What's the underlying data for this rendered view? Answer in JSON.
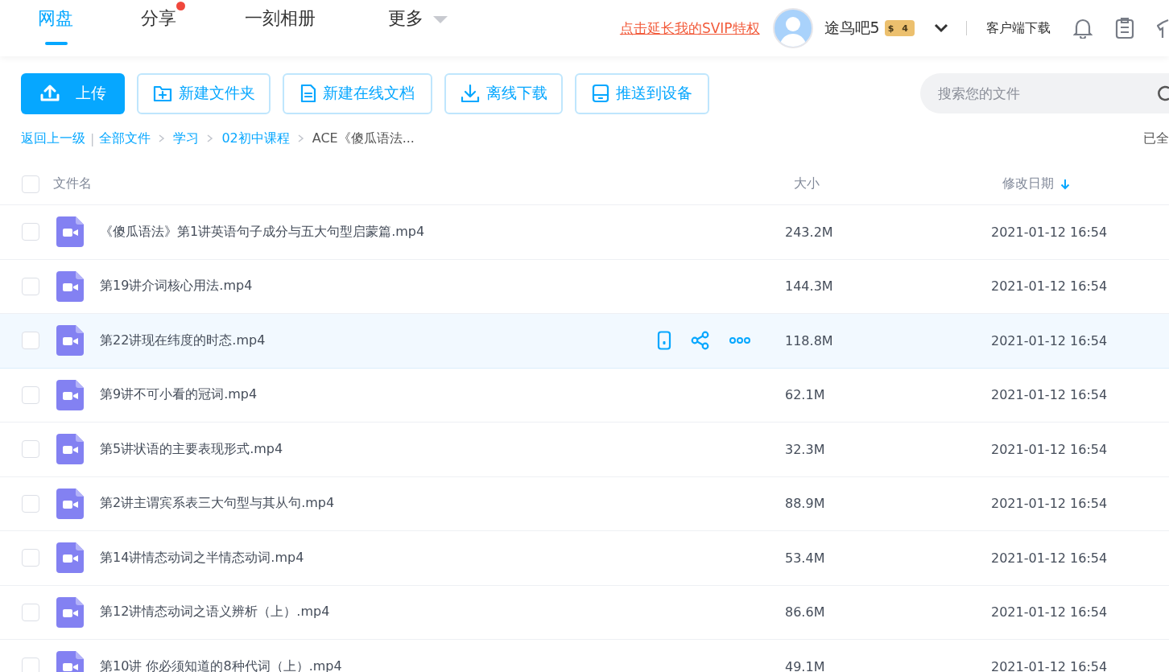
{
  "nav": {
    "tabs": [
      {
        "label": "网盘",
        "selected": true,
        "dot": false,
        "caret": false
      },
      {
        "label": "分享",
        "selected": false,
        "dot": true,
        "caret": false
      },
      {
        "label": "一刻相册",
        "selected": false,
        "dot": false,
        "caret": false
      },
      {
        "label": "更多",
        "selected": false,
        "dot": false,
        "caret": true
      }
    ],
    "promo_link": "点击延长我的SVIP特权",
    "user": {
      "name": "途鸟吧5",
      "badge_symbol": "$",
      "badge_level": "4"
    },
    "client_download": "客户端下载"
  },
  "toolbar": {
    "buttons": [
      {
        "label": "上传",
        "kind": "upload"
      },
      {
        "label": "新建文件夹",
        "kind": "folder"
      },
      {
        "label": "新建在线文档",
        "kind": "doc"
      },
      {
        "label": "离线下载",
        "kind": "download"
      },
      {
        "label": "推送到设备",
        "kind": "device"
      }
    ],
    "search": {
      "placeholder": "搜索您的文件"
    }
  },
  "breadcrumb": {
    "back": "返回上一级",
    "separator": "|",
    "items": [
      "全部文件",
      "学习",
      "02初中课程"
    ],
    "current": "ACE《傻瓜语法...",
    "right_text": "已全"
  },
  "table": {
    "columns": [
      "文件名",
      "大小",
      "修改日期"
    ],
    "select_all": false,
    "rows": [
      {
        "name": "《傻瓜语法》第1讲英语句子成分与五大句型启蒙篇.mp4",
        "size": "243.2M",
        "date": "2021-01-12 16:54",
        "checked": false,
        "hovered": false
      },
      {
        "name": "第19讲介词核心用法.mp4",
        "size": "144.3M",
        "date": "2021-01-12 16:54",
        "checked": false,
        "hovered": false
      },
      {
        "name": "第22讲现在纬度的时态.mp4",
        "size": "118.8M",
        "date": "2021-01-12 16:54",
        "checked": false,
        "hovered": true
      },
      {
        "name": "第9讲不可小看的冠词.mp4",
        "size": "62.1M",
        "date": "2021-01-12 16:54",
        "checked": false,
        "hovered": false
      },
      {
        "name": "第5讲状语的主要表现形式.mp4",
        "size": "32.3M",
        "date": "2021-01-12 16:54",
        "checked": false,
        "hovered": false
      },
      {
        "name": "第2讲主谓宾系表三大句型与其从句.mp4",
        "size": "88.9M",
        "date": "2021-01-12 16:54",
        "checked": false,
        "hovered": false
      },
      {
        "name": "第14讲情态动词之半情态动词.mp4",
        "size": "53.4M",
        "date": "2021-01-12 16:54",
        "checked": false,
        "hovered": false
      },
      {
        "name": "第12讲情态动词之语义辨析（上）.mp4",
        "size": "86.6M",
        "date": "2021-01-12 16:54",
        "checked": false,
        "hovered": false
      },
      {
        "name": "第10讲 你必须知道的8种代词（上）.mp4",
        "size": "49.1M",
        "date": "2021-01-12 16:54",
        "checked": false,
        "hovered": false
      }
    ]
  }
}
